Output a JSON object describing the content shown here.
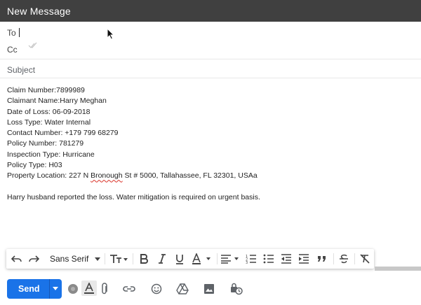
{
  "window": {
    "title": "New Message"
  },
  "fields": {
    "to_label": "To",
    "cc_label": "Cc",
    "subject_placeholder": "Subject"
  },
  "message": {
    "lines": [
      "Claim Number:7899989",
      "Claimant Name:Harry Meghan",
      "Date of Loss: 06-09-2018",
      "Loss Type: Water Internal",
      "Contact Number: +179 799 68279",
      "Policy Number: 781279",
      "Inspection Type: Hurricane",
      "Policy Type: H03"
    ],
    "location_prefix": "Property Location: 227 N ",
    "location_misspelled": "Bronough",
    "location_suffix": " St # 5000, Tallahassee, FL 32301, USAa",
    "note": "Harry husband reported the loss. Water mitigation is required on urgent basis."
  },
  "formatting": {
    "font_family": "Sans Serif"
  },
  "actions": {
    "send_label": "Send"
  },
  "colors": {
    "titlebar": "#404040",
    "send": "#1a73e8",
    "spellcheck": "#d93025"
  }
}
